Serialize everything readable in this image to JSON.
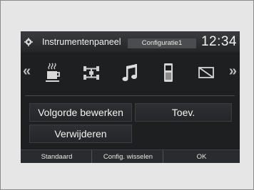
{
  "header": {
    "title": "Instrumentenpaneel",
    "config_label": "Configuratie1",
    "clock": "12:34"
  },
  "icons": [
    {
      "name": "coffee-cup-icon"
    },
    {
      "name": "drivetrain-icon"
    },
    {
      "name": "music-note-icon"
    },
    {
      "name": "phone-icon"
    },
    {
      "name": "no-display-icon"
    }
  ],
  "buttons": {
    "reorder": "Volgorde bewerken",
    "add": "Toev.",
    "delete": "Verwijderen"
  },
  "footer": {
    "default": "Standaard",
    "switch_config": "Config. wisselen",
    "ok": "OK"
  }
}
